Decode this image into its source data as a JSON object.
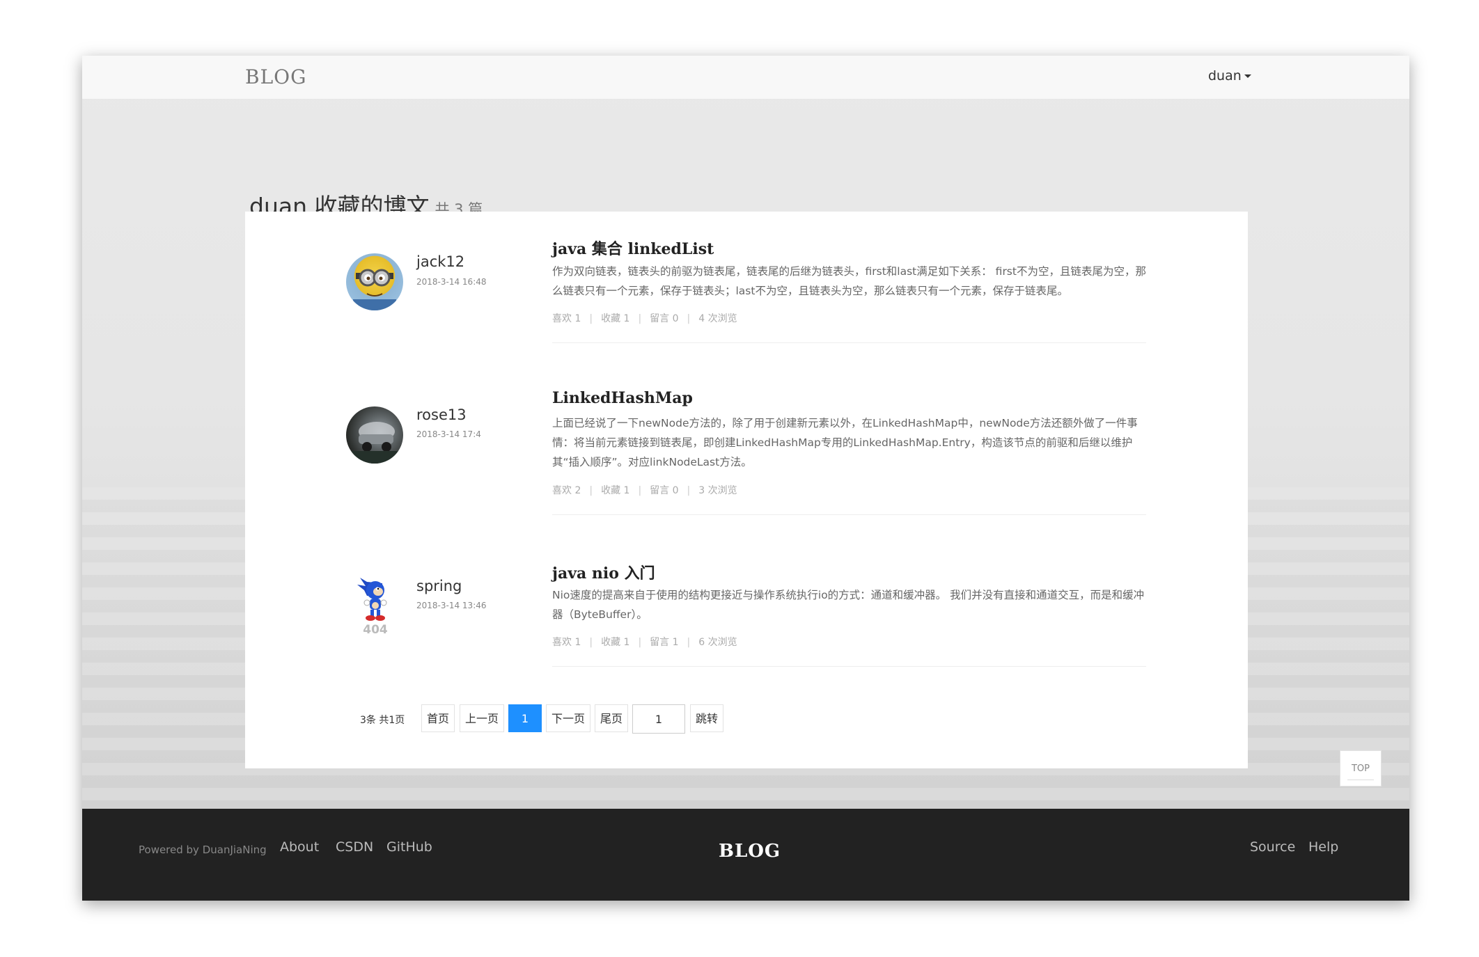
{
  "navbar": {
    "brand": "BLOG",
    "user": "duan"
  },
  "page": {
    "title": "duan 收藏的博文",
    "count": "共 3 篇"
  },
  "posts": [
    {
      "author": "jack12",
      "date": "2018-3-14 16:48",
      "avatar_icon": "minion-avatar",
      "title": "java 集合 linkedList",
      "excerpt": "作为双向链表，链表头的前驱为链表尾，链表尾的后继为链表头，first和last满足如下关系： first不为空，且链表尾为空，那么链表只有一个元素，保存于链表头；last不为空，且链表头为空，那么链表只有一个元素，保存于链表尾。",
      "likes": "喜欢 1",
      "favorites": "收藏 1",
      "comments": "留言 0",
      "views": "4 次浏览"
    },
    {
      "author": "rose13",
      "date": "2018-3-14 17:4",
      "avatar_icon": "car-photo-avatar",
      "title": "LinkedHashMap",
      "excerpt": "上面已经说了一下newNode方法的，除了用于创建新元素以外，在LinkedHashMap中，newNode方法还额外做了一件事情：将当前元素链接到链表尾，即创建LinkedHashMap专用的LinkedHashMap.Entry，构造该节点的前驱和后继以维护其“插入顺序”。对应linkNodeLast方法。",
      "likes": "喜欢 2",
      "favorites": "收藏 1",
      "comments": "留言 0",
      "views": "3 次浏览"
    },
    {
      "author": "spring",
      "date": "2018-3-14 13:46",
      "avatar_icon": "sonic-404-avatar",
      "avatar_text": "404",
      "title": "java nio 入门",
      "excerpt": "Nio速度的提高来自于使用的结构更接近与操作系统执行io的方式：通道和缓冲器。 我们并没有直接和通道交互，而是和缓冲器（ByteBuffer）。",
      "likes": "喜欢 1",
      "favorites": "收藏 1",
      "comments": "留言 1",
      "views": "6 次浏览"
    }
  ],
  "pagination": {
    "info": "3条 共1页",
    "first": "首页",
    "prev": "上一页",
    "current": "1",
    "next": "下一页",
    "last": "尾页",
    "jump_value": "1",
    "jump": "跳转"
  },
  "top_button": "TOP",
  "footer": {
    "powered": "Powered by DuanJiaNing",
    "links": [
      "About",
      "CSDN",
      "GitHub"
    ],
    "brand": "BLOG",
    "right_links": [
      "Source",
      "Help"
    ]
  },
  "colors": {
    "accent": "#1e90ff",
    "footer_bg": "#222222",
    "navbar_bg": "#f8f8f8"
  }
}
